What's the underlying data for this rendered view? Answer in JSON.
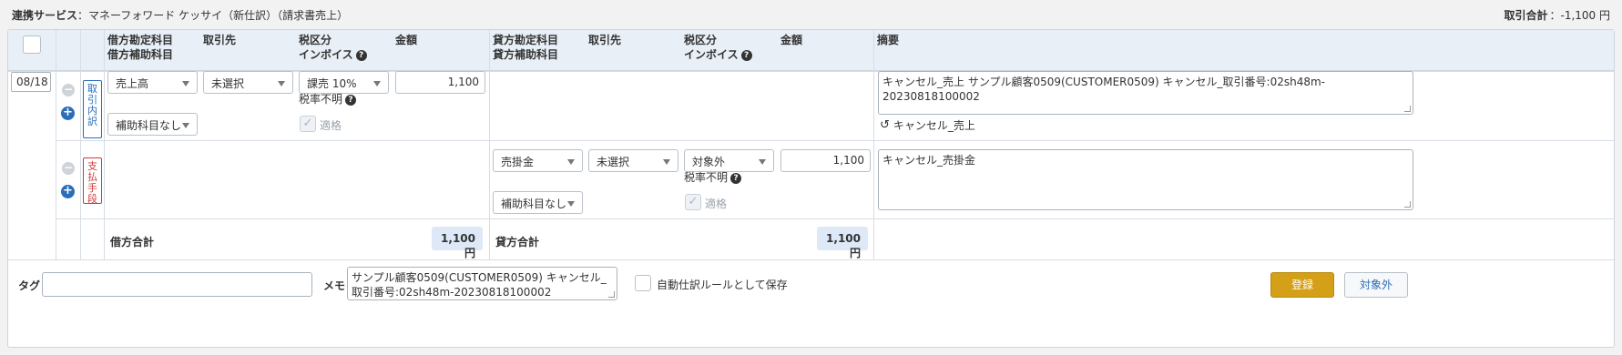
{
  "header": {
    "service_label": "連携サービス",
    "service_value": "：マネーフォワード ケッサイ（新仕訳）（請求書売上）",
    "total_label": "取引合計",
    "total_value": "：-1,100 円"
  },
  "columns": {
    "debit_account": "借方勘定科目",
    "debit_sub": "借方補助科目",
    "debit_partner": "取引先",
    "debit_tax": "税区分",
    "debit_invoice": "インボイス",
    "debit_amount": "金額",
    "credit_account": "貸方勘定科目",
    "credit_sub": "貸方補助科目",
    "credit_partner": "取引先",
    "credit_tax": "税区分",
    "credit_invoice": "インボイス",
    "credit_amount": "金額",
    "memo": "摘要"
  },
  "row": {
    "date": "08/18",
    "tag_torihiki": "取引内訳",
    "tag_shiharai": "支払手段"
  },
  "entry1": {
    "account": "売上高",
    "partner": "未選択",
    "tax": "課売 10%",
    "amount": "1,100",
    "tax_rate": "税率不明",
    "sub": "補助科目なし",
    "qualified": "適格",
    "memo": "キャンセル_売上 サンプル顧客0509(CUSTOMER0509) キャンセル_取引番号:02sh48m-20230818100002",
    "undo_label": "キャンセル_売上"
  },
  "entry2": {
    "account": "売掛金",
    "partner": "未選択",
    "tax": "対象外",
    "amount": "1,100",
    "tax_rate": "税率不明",
    "sub": "補助科目なし",
    "qualified": "適格",
    "memo": "キャンセル_売掛金"
  },
  "totals": {
    "debit_label": "借方合計",
    "debit_value": "1,100円",
    "credit_label": "貸方合計",
    "credit_value": "1,100円"
  },
  "footer": {
    "tag_label": "タグ",
    "memo_label": "メモ",
    "memo_value": "サンプル顧客0509(CUSTOMER0509) キャンセル_取引番号:02sh48m-20230818100002",
    "rule_label": "自動仕訳ルールとして保存",
    "register_label": "登録",
    "exclude_label": "対象外"
  },
  "colors": {
    "accent": "#2a6db8",
    "register": "#d4a017",
    "header_bg": "#e8eff7"
  }
}
